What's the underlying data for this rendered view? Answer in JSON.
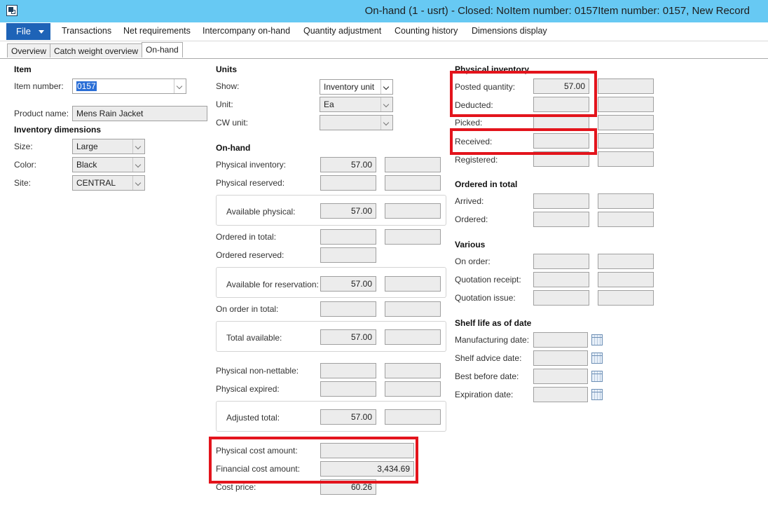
{
  "window": {
    "title": "On-hand (1 - usrt) - Closed: NoItem number: 0157Item number: 0157, New Record"
  },
  "menu": {
    "file": "File",
    "items": [
      "Transactions",
      "Net requirements",
      "Intercompany on-hand",
      "Quantity adjustment",
      "Counting history",
      "Dimensions display"
    ]
  },
  "tabs": [
    "Overview",
    "Catch weight overview",
    "On-hand"
  ],
  "item": {
    "header": "Item",
    "item_number_label": "Item number:",
    "item_number": "0157",
    "product_name_label": "Product name:",
    "product_name": "Mens Rain Jacket"
  },
  "inventory_dimensions": {
    "header": "Inventory dimensions",
    "size_label": "Size:",
    "size": "Large",
    "color_label": "Color:",
    "color": "Black",
    "site_label": "Site:",
    "site": "CENTRAL"
  },
  "units": {
    "header": "Units",
    "show_label": "Show:",
    "show": "Inventory unit",
    "unit_label": "Unit:",
    "unit": "Ea",
    "cw_unit_label": "CW unit:",
    "cw_unit": ""
  },
  "onhand": {
    "header": "On-hand",
    "physical_inventory_label": "Physical inventory:",
    "physical_inventory": "57.00",
    "physical_reserved_label": "Physical reserved:",
    "physical_reserved": "",
    "available_physical_label": "Available physical:",
    "available_physical": "57.00",
    "ordered_in_total_label": "Ordered in total:",
    "ordered_in_total": "",
    "ordered_reserved_label": "Ordered reserved:",
    "ordered_reserved": "",
    "available_for_reservation_label": "Available for reservation:",
    "available_for_reservation": "57.00",
    "on_order_in_total_label": "On order in total:",
    "on_order_in_total": "",
    "total_available_label": "Total available:",
    "total_available": "57.00",
    "physical_non_nettable_label": "Physical non-nettable:",
    "physical_non_nettable": "",
    "physical_expired_label": "Physical expired:",
    "physical_expired": "",
    "adjusted_total_label": "Adjusted total:",
    "adjusted_total": "57.00",
    "physical_cost_amount_label": "Physical cost amount:",
    "physical_cost_amount": "",
    "financial_cost_amount_label": "Financial cost amount:",
    "financial_cost_amount": "3,434.69",
    "cost_price_label": "Cost price:",
    "cost_price": "60.26"
  },
  "physical_inventory": {
    "header": "Physical inventory",
    "posted_quantity_label": "Posted quantity:",
    "posted_quantity": "57.00",
    "deducted_label": "Deducted:",
    "deducted": "",
    "picked_label": "Picked:",
    "picked": "",
    "received_label": "Received:",
    "received": "",
    "registered_label": "Registered:",
    "registered": ""
  },
  "ordered_in_total": {
    "header": "Ordered in total",
    "arrived_label": "Arrived:",
    "arrived": "",
    "ordered_label": "Ordered:",
    "ordered": ""
  },
  "various": {
    "header": "Various",
    "on_order_label": "On order:",
    "on_order": "",
    "quotation_receipt_label": "Quotation receipt:",
    "quotation_receipt": "",
    "quotation_issue_label": "Quotation issue:",
    "quotation_issue": ""
  },
  "shelf_life": {
    "header": "Shelf life as of date",
    "manufacturing_date_label": "Manufacturing date:",
    "manufacturing_date": "",
    "shelf_advice_date_label": "Shelf advice date:",
    "shelf_advice_date": "",
    "best_before_date_label": "Best before date:",
    "best_before_date": "",
    "expiration_date_label": "Expiration date:",
    "expiration_date": ""
  },
  "colors": {
    "titlebar": "#67c9f3",
    "file_button": "#1e63b7",
    "highlight_box": "#e3141c"
  }
}
